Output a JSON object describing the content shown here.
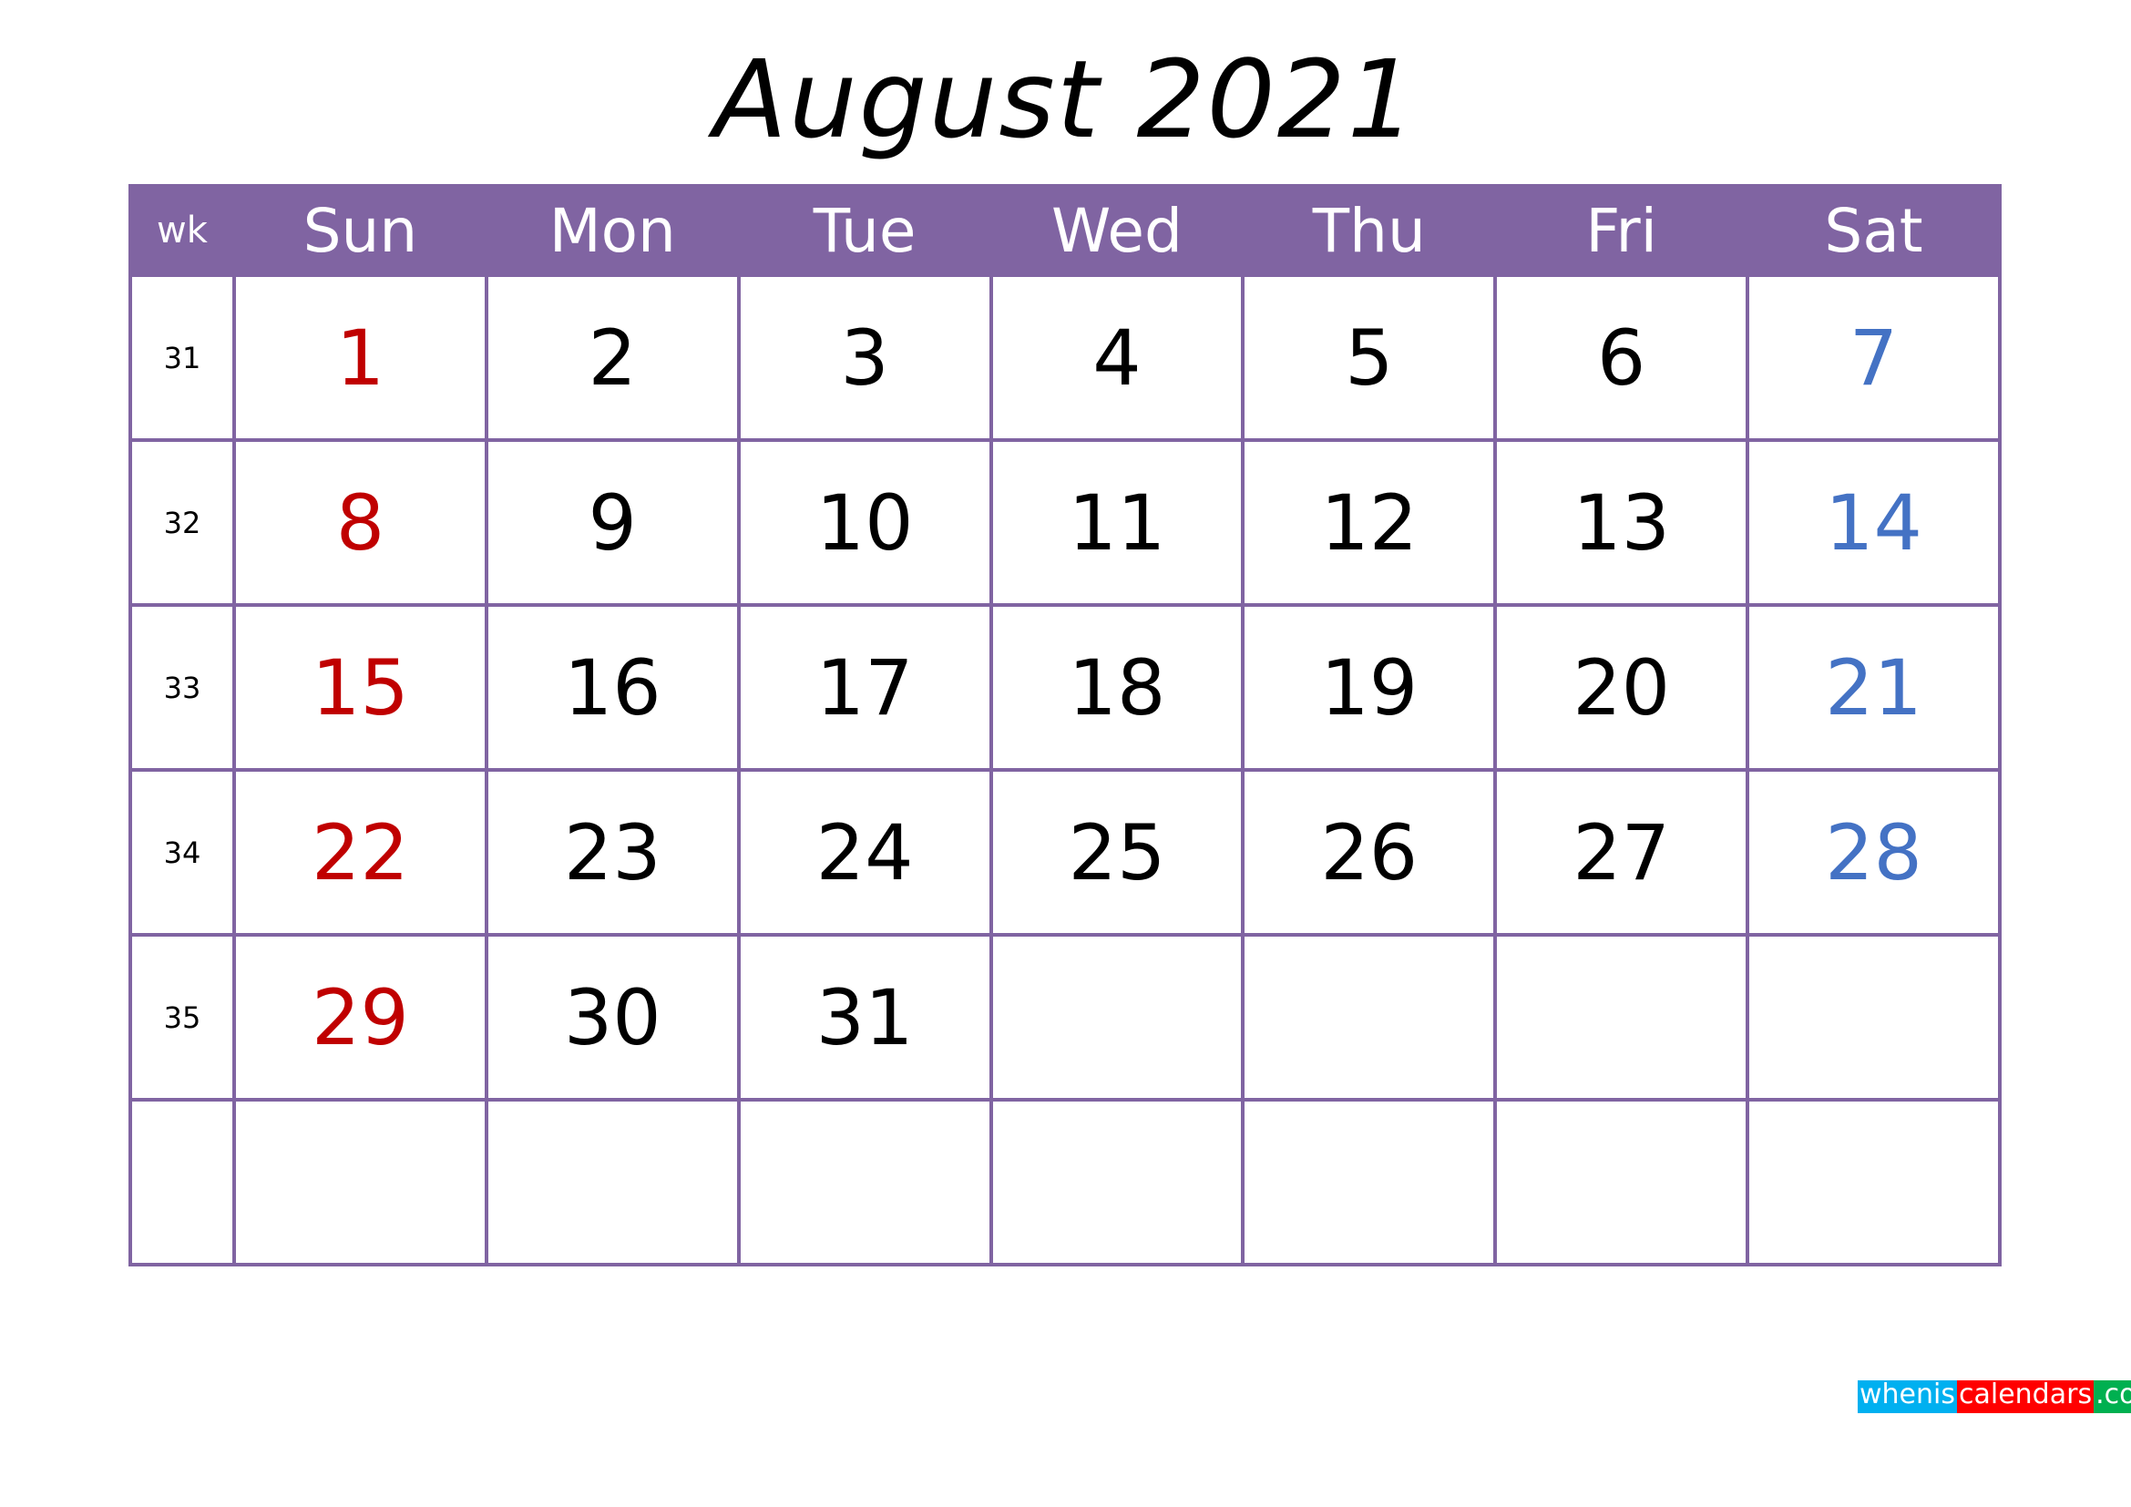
{
  "title": "August 2021",
  "colors": {
    "header_bg": "#8064A2",
    "sunday": "#C00000",
    "saturday": "#4472C4",
    "grid": "#8064A2"
  },
  "header": {
    "wk": "wk",
    "days": [
      "Sun",
      "Mon",
      "Tue",
      "Wed",
      "Thu",
      "Fri",
      "Sat"
    ]
  },
  "weeks": [
    {
      "wk": "31",
      "days": [
        "1",
        "2",
        "3",
        "4",
        "5",
        "6",
        "7"
      ]
    },
    {
      "wk": "32",
      "days": [
        "8",
        "9",
        "10",
        "11",
        "12",
        "13",
        "14"
      ]
    },
    {
      "wk": "33",
      "days": [
        "15",
        "16",
        "17",
        "18",
        "19",
        "20",
        "21"
      ]
    },
    {
      "wk": "34",
      "days": [
        "22",
        "23",
        "24",
        "25",
        "26",
        "27",
        "28"
      ]
    },
    {
      "wk": "35",
      "days": [
        "29",
        "30",
        "31",
        "",
        "",
        "",
        ""
      ]
    },
    {
      "wk": "",
      "days": [
        "",
        "",
        "",
        "",
        "",
        "",
        ""
      ]
    }
  ],
  "logo": {
    "part1": "whenis",
    "part2": "calendars",
    "part3": ".com"
  }
}
